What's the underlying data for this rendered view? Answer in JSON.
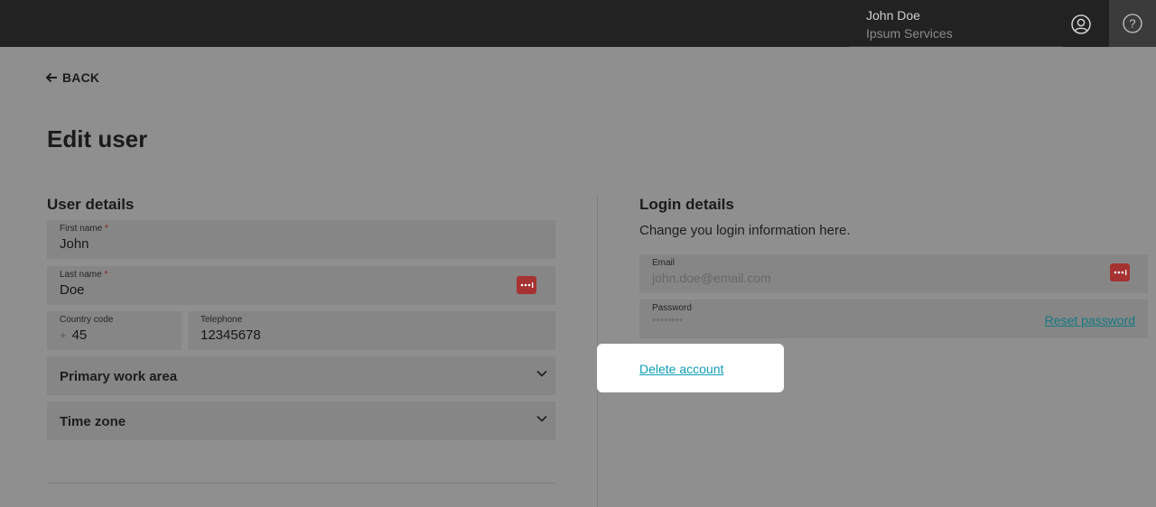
{
  "header": {
    "user_name": "John Doe",
    "company": "Ipsum Services",
    "avatar_icon": "user-circle-icon",
    "help_icon": "help-circle-icon"
  },
  "nav": {
    "back_label": "BACK"
  },
  "page": {
    "title": "Edit user"
  },
  "user_details": {
    "title": "User details",
    "first_name": {
      "label": "First name",
      "required_mark": "*",
      "value": "John"
    },
    "last_name": {
      "label": "Last name",
      "required_mark": "*",
      "value": "Doe"
    },
    "country_code": {
      "label": "Country code",
      "prefix": "+",
      "value": "45"
    },
    "telephone": {
      "label": "Telephone",
      "value": "12345678"
    },
    "primary_work_area": {
      "label": "Primary work area"
    },
    "time_zone": {
      "label": "Time zone"
    }
  },
  "login_details": {
    "title": "Login details",
    "subtitle": "Change you login information here.",
    "email": {
      "label": "Email",
      "placeholder": "john.doe@email.com"
    },
    "password": {
      "label": "Password",
      "value": "********",
      "reset_label": "Reset password"
    },
    "delete_label": "Delete account"
  },
  "colors": {
    "accent_link": "#0d9eb8",
    "password_manager_badge": "#a63232",
    "header_bg": "#222222"
  }
}
